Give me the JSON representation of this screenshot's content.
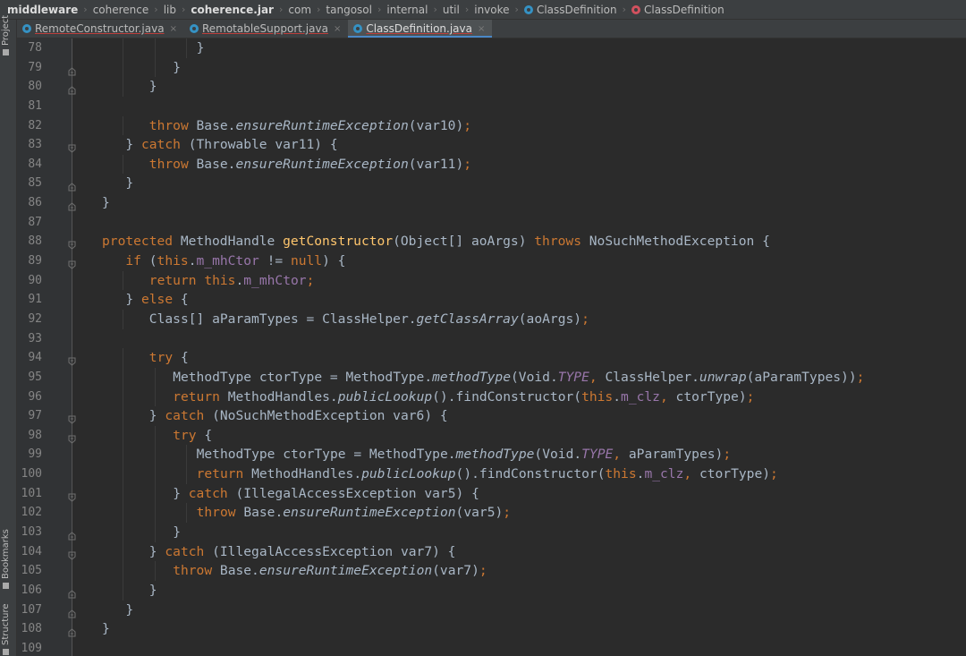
{
  "breadcrumbs": [
    {
      "label": "middleware",
      "bold": true
    },
    {
      "label": "coherence"
    },
    {
      "label": "lib"
    },
    {
      "label": "coherence.jar",
      "bold": true
    },
    {
      "label": "com"
    },
    {
      "label": "tangosol"
    },
    {
      "label": "internal"
    },
    {
      "label": "util"
    },
    {
      "label": "invoke"
    },
    {
      "label": "ClassDefinition",
      "icon": "class-icon"
    },
    {
      "label": "ClassDefinition",
      "icon": "method-icon"
    }
  ],
  "tool_strip": {
    "project": "Project",
    "bookmarks": "Bookmarks",
    "structure": "Structure"
  },
  "tabs": [
    {
      "label": "RemoteConstructor.java",
      "active": false
    },
    {
      "label": "RemotableSupport.java",
      "active": false
    },
    {
      "label": "ClassDefinition.java",
      "active": true
    }
  ],
  "colors": {
    "keyword": "#cc7832",
    "function": "#ffc66d",
    "field": "#9876aa",
    "default": "#a9b7c6",
    "background": "#2b2b2b"
  },
  "code_lines": [
    {
      "n": "78",
      "indent": 4,
      "fold": "",
      "tokens": [
        [
          "}",
          ""
        ]
      ]
    },
    {
      "n": "79",
      "indent": 3,
      "fold": "end",
      "tokens": [
        [
          "}",
          ""
        ]
      ]
    },
    {
      "n": "80",
      "indent": 2,
      "fold": "end",
      "tokens": [
        [
          "}",
          ""
        ]
      ]
    },
    {
      "n": "81",
      "indent": 0,
      "fold": "",
      "tokens": []
    },
    {
      "n": "82",
      "indent": 2,
      "fold": "",
      "tokens": [
        [
          "throw",
          "kw"
        ],
        [
          " Base.",
          ""
        ],
        [
          "ensureRuntimeException",
          "it"
        ],
        [
          "(var10)",
          ""
        ],
        [
          ";",
          "kw"
        ]
      ]
    },
    {
      "n": "83",
      "indent": 1,
      "fold": "start",
      "tokens": [
        [
          "} ",
          ""
        ],
        [
          "catch",
          "kw"
        ],
        [
          " (Throwable var11) {",
          ""
        ]
      ]
    },
    {
      "n": "84",
      "indent": 2,
      "fold": "",
      "tokens": [
        [
          "throw",
          "kw"
        ],
        [
          " Base.",
          ""
        ],
        [
          "ensureRuntimeException",
          "it"
        ],
        [
          "(var11)",
          ""
        ],
        [
          ";",
          "kw"
        ]
      ]
    },
    {
      "n": "85",
      "indent": 1,
      "fold": "end",
      "tokens": [
        [
          "}",
          ""
        ]
      ]
    },
    {
      "n": "86",
      "indent": 0,
      "fold": "end",
      "tokens": [
        [
          "}",
          ""
        ]
      ]
    },
    {
      "n": "87",
      "indent": 0,
      "fold": "",
      "tokens": []
    },
    {
      "n": "88",
      "indent": 0,
      "fold": "start",
      "tokens": [
        [
          "protected",
          "kw"
        ],
        [
          " MethodHandle ",
          ""
        ],
        [
          "getConstructor",
          "fn"
        ],
        [
          "(Object[] aoArgs) ",
          ""
        ],
        [
          "throws",
          "kw"
        ],
        [
          " NoSuchMethodException {",
          ""
        ]
      ]
    },
    {
      "n": "89",
      "indent": 1,
      "fold": "start",
      "tokens": [
        [
          "if",
          "kw"
        ],
        [
          " (",
          ""
        ],
        [
          "this",
          "kw"
        ],
        [
          ".",
          ""
        ],
        [
          "m_mhCtor",
          "pu"
        ],
        [
          " != ",
          ""
        ],
        [
          "null",
          "kw"
        ],
        [
          ") {",
          ""
        ]
      ]
    },
    {
      "n": "90",
      "indent": 2,
      "fold": "",
      "tokens": [
        [
          "return",
          "kw"
        ],
        [
          " ",
          ""
        ],
        [
          "this",
          "kw"
        ],
        [
          ".",
          ""
        ],
        [
          "m_mhCtor",
          "pu"
        ],
        [
          ";",
          "kw"
        ]
      ]
    },
    {
      "n": "91",
      "indent": 1,
      "fold": "",
      "tokens": [
        [
          "} ",
          ""
        ],
        [
          "else",
          "kw"
        ],
        [
          " {",
          ""
        ]
      ]
    },
    {
      "n": "92",
      "indent": 2,
      "fold": "",
      "tokens": [
        [
          "Class[] aParamTypes = ClassHelper.",
          ""
        ],
        [
          "getClassArray",
          "it"
        ],
        [
          "(aoArgs)",
          ""
        ],
        [
          ";",
          "kw"
        ]
      ]
    },
    {
      "n": "93",
      "indent": 0,
      "fold": "",
      "tokens": []
    },
    {
      "n": "94",
      "indent": 2,
      "fold": "start",
      "tokens": [
        [
          "try",
          "kw"
        ],
        [
          " {",
          ""
        ]
      ]
    },
    {
      "n": "95",
      "indent": 3,
      "fold": "",
      "tokens": [
        [
          "MethodType ctorType = MethodType.",
          ""
        ],
        [
          "methodType",
          "it"
        ],
        [
          "(Void.",
          ""
        ],
        [
          "TYPE",
          "pui"
        ],
        [
          ", ",
          "kw"
        ],
        [
          "ClassHelper.",
          ""
        ],
        [
          "unwrap",
          "it"
        ],
        [
          "(aParamTypes))",
          ""
        ],
        [
          ";",
          "kw"
        ]
      ]
    },
    {
      "n": "96",
      "indent": 3,
      "fold": "",
      "tokens": [
        [
          "return",
          "kw"
        ],
        [
          " MethodHandles.",
          ""
        ],
        [
          "publicLookup",
          "it"
        ],
        [
          "().findConstructor(",
          ""
        ],
        [
          "this",
          "kw"
        ],
        [
          ".",
          ""
        ],
        [
          "m_clz",
          "pu"
        ],
        [
          ", ",
          "kw"
        ],
        [
          "ctorType)",
          ""
        ],
        [
          ";",
          "kw"
        ]
      ]
    },
    {
      "n": "97",
      "indent": 2,
      "fold": "start",
      "tokens": [
        [
          "} ",
          ""
        ],
        [
          "catch",
          "kw"
        ],
        [
          " (NoSuchMethodException var6) {",
          ""
        ]
      ]
    },
    {
      "n": "98",
      "indent": 3,
      "fold": "start",
      "tokens": [
        [
          "try",
          "kw"
        ],
        [
          " {",
          ""
        ]
      ]
    },
    {
      "n": "99",
      "indent": 4,
      "fold": "",
      "tokens": [
        [
          "MethodType ctorType = MethodType.",
          ""
        ],
        [
          "methodType",
          "it"
        ],
        [
          "(Void.",
          ""
        ],
        [
          "TYPE",
          "pui"
        ],
        [
          ", ",
          "kw"
        ],
        [
          "aParamTypes)",
          ""
        ],
        [
          ";",
          "kw"
        ]
      ]
    },
    {
      "n": "100",
      "indent": 4,
      "fold": "",
      "tokens": [
        [
          "return",
          "kw"
        ],
        [
          " MethodHandles.",
          ""
        ],
        [
          "publicLookup",
          "it"
        ],
        [
          "().findConstructor(",
          ""
        ],
        [
          "this",
          "kw"
        ],
        [
          ".",
          ""
        ],
        [
          "m_clz",
          "pu"
        ],
        [
          ", ",
          "kw"
        ],
        [
          "ctorType)",
          ""
        ],
        [
          ";",
          "kw"
        ]
      ]
    },
    {
      "n": "101",
      "indent": 3,
      "fold": "start",
      "tokens": [
        [
          "} ",
          ""
        ],
        [
          "catch",
          "kw"
        ],
        [
          " (IllegalAccessException var5) {",
          ""
        ]
      ]
    },
    {
      "n": "102",
      "indent": 4,
      "fold": "",
      "tokens": [
        [
          "throw",
          "kw"
        ],
        [
          " Base.",
          ""
        ],
        [
          "ensureRuntimeException",
          "it"
        ],
        [
          "(var5)",
          ""
        ],
        [
          ";",
          "kw"
        ]
      ]
    },
    {
      "n": "103",
      "indent": 3,
      "fold": "end",
      "tokens": [
        [
          "}",
          ""
        ]
      ]
    },
    {
      "n": "104",
      "indent": 2,
      "fold": "start",
      "tokens": [
        [
          "} ",
          ""
        ],
        [
          "catch",
          "kw"
        ],
        [
          " (IllegalAccessException var7) {",
          ""
        ]
      ]
    },
    {
      "n": "105",
      "indent": 3,
      "fold": "",
      "tokens": [
        [
          "throw",
          "kw"
        ],
        [
          " Base.",
          ""
        ],
        [
          "ensureRuntimeException",
          "it"
        ],
        [
          "(var7)",
          ""
        ],
        [
          ";",
          "kw"
        ]
      ]
    },
    {
      "n": "106",
      "indent": 2,
      "fold": "end",
      "tokens": [
        [
          "}",
          ""
        ]
      ]
    },
    {
      "n": "107",
      "indent": 1,
      "fold": "end",
      "tokens": [
        [
          "}",
          ""
        ]
      ]
    },
    {
      "n": "108",
      "indent": 0,
      "fold": "end",
      "tokens": [
        [
          "}",
          ""
        ]
      ]
    },
    {
      "n": "109",
      "indent": 0,
      "fold": "",
      "tokens": []
    }
  ]
}
